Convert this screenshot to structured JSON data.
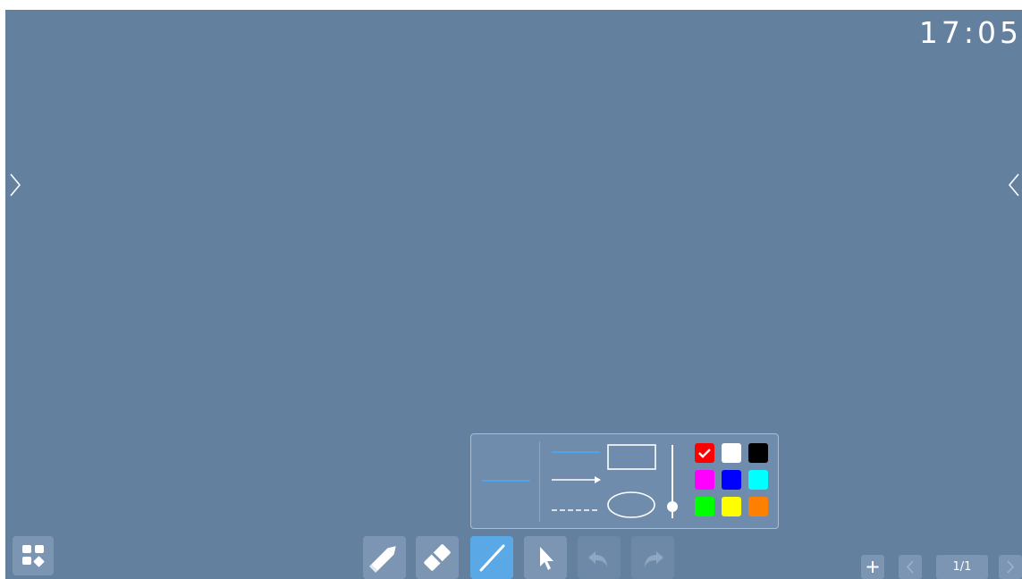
{
  "clock": {
    "time": "17:05"
  },
  "pagination": {
    "indicator": "1/1"
  },
  "icons": {
    "apps": "apps-grid-icon",
    "pen": "pencil-icon",
    "eraser": "eraser-icon",
    "line": "line-tool-icon",
    "select": "cursor-arrow-icon",
    "undo": "undo-icon",
    "redo": "redo-icon",
    "add_page": "plus-icon",
    "prev_page": "chevron-left-icon",
    "next_page": "chevron-right-icon",
    "left_drawer": "chevron-right-icon",
    "right_drawer": "chevron-left-icon"
  },
  "shape_panel": {
    "shapes": [
      "line",
      "arrow",
      "dashed-line",
      "rectangle",
      "ellipse"
    ],
    "selected_shape": "line",
    "stroke_thickness": 0.1,
    "colors": [
      {
        "name": "red",
        "hex": "#ff0000",
        "selected": true
      },
      {
        "name": "white",
        "hex": "#ffffff",
        "selected": false
      },
      {
        "name": "black",
        "hex": "#000000",
        "selected": false
      },
      {
        "name": "magenta",
        "hex": "#ff00ff",
        "selected": false
      },
      {
        "name": "blue",
        "hex": "#0000ff",
        "selected": false
      },
      {
        "name": "cyan",
        "hex": "#00ffff",
        "selected": false
      },
      {
        "name": "green",
        "hex": "#00ff00",
        "selected": false
      },
      {
        "name": "yellow",
        "hex": "#ffff00",
        "selected": false
      },
      {
        "name": "orange",
        "hex": "#ff7f00",
        "selected": false
      }
    ]
  },
  "theme": {
    "board_background": "#63809f",
    "button_background": "#7b95b3",
    "active_tool": "#5aa8e6",
    "line_preview": "#4fa3e6"
  }
}
